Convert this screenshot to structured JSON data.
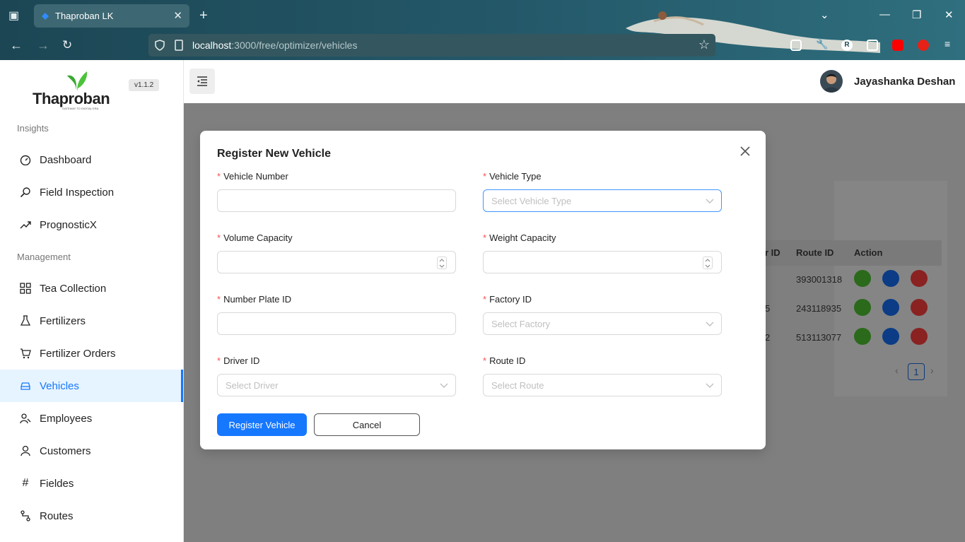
{
  "browser": {
    "tab_title": "Thaproban LK",
    "url_host": "localhost",
    "url_path": ":3000/free/optimizer/vehicles"
  },
  "sidebar": {
    "logo_text": "Thaproban",
    "logo_tagline": "GATEWAY TO DIGITAL ERA",
    "version": "v1.1.2",
    "sections": [
      {
        "label": "Insights"
      },
      {
        "label": "Management"
      }
    ],
    "items": [
      {
        "label": "Dashboard",
        "icon": "dashboard-icon"
      },
      {
        "label": "Field Inspection",
        "icon": "search-icon"
      },
      {
        "label": "PrognosticX",
        "icon": "trend-icon"
      },
      {
        "label": "Tea Collection",
        "icon": "grid-icon"
      },
      {
        "label": "Fertilizers",
        "icon": "flask-icon"
      },
      {
        "label": "Fertilizer Orders",
        "icon": "cart-icon"
      },
      {
        "label": "Vehicles",
        "icon": "car-icon",
        "active": true
      },
      {
        "label": "Employees",
        "icon": "users-icon"
      },
      {
        "label": "Customers",
        "icon": "user-icon"
      },
      {
        "label": "Fieldes",
        "icon": "hash-icon"
      },
      {
        "label": "Routes",
        "icon": "route-icon"
      }
    ]
  },
  "header": {
    "user_name": "Jayashanka Deshan"
  },
  "background_table": {
    "headers": [
      "r ID",
      "Route ID",
      "Action"
    ],
    "rows": [
      {
        "partial": "",
        "route_id": "393001318"
      },
      {
        "partial": "5",
        "route_id": "243118935"
      },
      {
        "partial": "2",
        "route_id": "513113077"
      }
    ],
    "page": "1"
  },
  "modal": {
    "title": "Register New Vehicle",
    "fields": {
      "vehicle_number": {
        "label": "Vehicle Number",
        "value": "",
        "placeholder": ""
      },
      "vehicle_type": {
        "label": "Vehicle Type",
        "placeholder": "Select Vehicle Type"
      },
      "volume_capacity": {
        "label": "Volume Capacity",
        "value": ""
      },
      "weight_capacity": {
        "label": "Weight Capacity",
        "value": ""
      },
      "number_plate_id": {
        "label": "Number Plate ID",
        "value": ""
      },
      "factory_id": {
        "label": "Factory ID",
        "placeholder": "Select Factory"
      },
      "driver_id": {
        "label": "Driver ID",
        "placeholder": "Select Driver"
      },
      "route_id": {
        "label": "Route ID",
        "placeholder": "Select Route"
      }
    },
    "submit_label": "Register Vehicle",
    "cancel_label": "Cancel"
  },
  "colors": {
    "primary": "#1677ff",
    "required": "#ff4d4f",
    "view_action": "#52c41a",
    "edit_action": "#1677ff",
    "delete_action": "#ff4d4f"
  }
}
